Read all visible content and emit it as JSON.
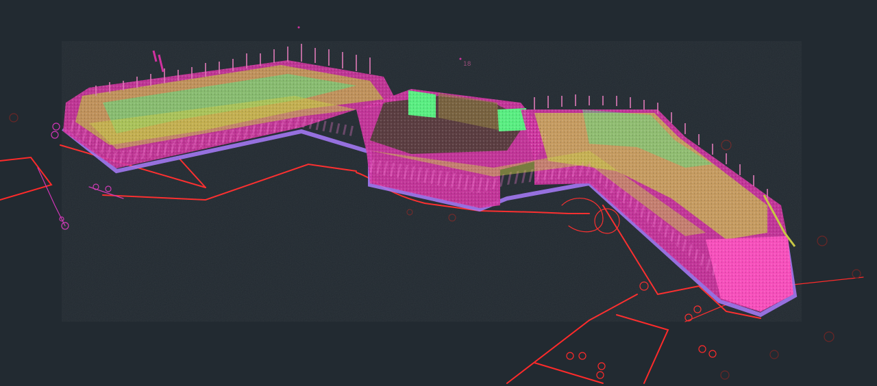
{
  "viewport": {
    "background": "#222a31"
  },
  "scene": {
    "point_cloud_colors": {
      "outer_wall": "#e03fae",
      "wall_highlight": "#ff4fc0",
      "base_edge": "#a879ff",
      "roof_green": "#55f07f",
      "roof_yellow": "#c7c844",
      "interior_dark": "#4b3a32",
      "orange": "#d9643a"
    },
    "cad_colors": {
      "red_line": "#ff2a2a",
      "magenta_line": "#d136b7",
      "dark_red": "#8f2d2d"
    },
    "floating_text": "18"
  }
}
